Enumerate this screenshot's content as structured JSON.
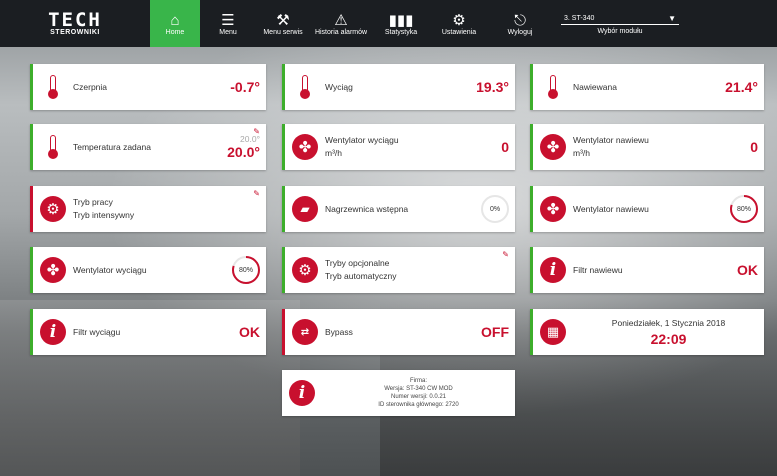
{
  "brand": {
    "main": "TECH",
    "sub": "STEROWNIKI"
  },
  "nav": [
    {
      "label": "Home",
      "icon": "home-icon",
      "active": true
    },
    {
      "label": "Menu",
      "icon": "menu-icon",
      "active": false
    },
    {
      "label": "Menu serwis",
      "icon": "service-icon",
      "active": false
    },
    {
      "label": "Historia alarmów",
      "icon": "alarm-icon",
      "active": false
    },
    {
      "label": "Statystyka",
      "icon": "stats-icon",
      "active": false
    },
    {
      "label": "Ustawienia",
      "icon": "settings-icon",
      "active": false
    },
    {
      "label": "Wyloguj",
      "icon": "logout-icon",
      "active": false
    }
  ],
  "module": {
    "selected": "3. ST-340",
    "label": "Wybór modułu"
  },
  "colors": {
    "accent_red": "#c8102e",
    "accent_green": "#3dae2b",
    "topbar": "#1b1e22"
  },
  "tiles": {
    "czerpnia": {
      "label": "Czerpnia",
      "value": "-0.7°"
    },
    "wyciag": {
      "label": "Wyciąg",
      "value": "19.3°"
    },
    "nawiewana": {
      "label": "Nawiewana",
      "value": "21.4°"
    },
    "temp_zadana": {
      "label": "Temperatura zadana",
      "value_small": "20.0°",
      "value": "20.0°"
    },
    "went_wyciagu_m3": {
      "label": "Wentylator wyciągu",
      "unit": "m³/h",
      "value": "0"
    },
    "went_nawiewu_m3": {
      "label": "Wentylator nawiewu",
      "unit": "m³/h",
      "value": "0"
    },
    "tryb_pracy": {
      "label": "Tryb pracy",
      "value": "Tryb intensywny"
    },
    "nagrzewnica": {
      "label": "Nagrzewnica wstępna",
      "value": "0%"
    },
    "went_nawiewu": {
      "label": "Wentylator nawiewu",
      "value": "80%"
    },
    "went_wyciagu": {
      "label": "Wentylator wyciągu",
      "value": "80%"
    },
    "tryby_opcjonalne": {
      "label": "Tryby opcjonalne",
      "value": "Tryb automatyczny"
    },
    "filtr_nawiewu": {
      "label": "Filtr nawiewu",
      "value": "OK"
    },
    "filtr_wyciagu": {
      "label": "Filtr wyciągu",
      "value": "OK"
    },
    "bypass": {
      "label": "Bypass",
      "value": "OFF"
    },
    "datetime": {
      "date": "Poniedziałek, 1 Stycznia 2018",
      "time": "22:09"
    }
  },
  "firma": {
    "line1": "Firma:",
    "line2": "Wersja: ST-340 CW MOD",
    "line3": "Numer wersji: 0.0.21",
    "line4": "ID sterownika głównego: 2720"
  }
}
